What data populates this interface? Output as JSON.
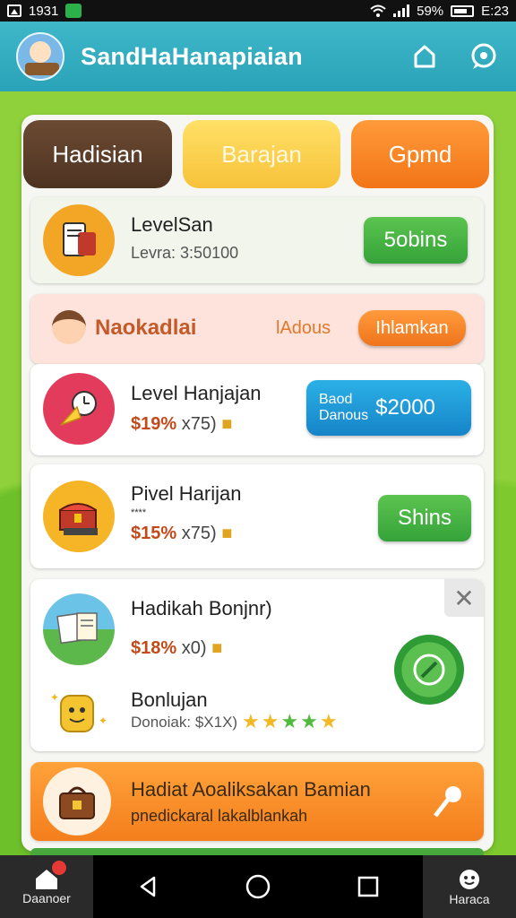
{
  "status_bar": {
    "left_text": "1931",
    "battery": "59%",
    "time": "E:23"
  },
  "header": {
    "title": "SandHaHanapiaian"
  },
  "tabs": [
    "Hadisian",
    "Barajan",
    "Gpmd"
  ],
  "level_row": {
    "title": "LevelSan",
    "sub_label": "Levra:",
    "sub_value": "3:50100",
    "button": "5obins"
  },
  "promo_row": {
    "name": "Naokadlai",
    "aux": "lAdous",
    "button": "Ihlamkan"
  },
  "item_rows": [
    {
      "title": "Level Hanjajan",
      "price": "$19%",
      "meta": "x75)",
      "button_line1": "Baod",
      "button_line2": "Danous",
      "button_price": "$2000"
    },
    {
      "title": "Pivel Harijan",
      "tiny_note": "****",
      "price": "$15%",
      "meta": "x75)",
      "button": "Shins"
    },
    {
      "title": "Hadikah Bonjnr)",
      "price": "$18%",
      "meta": "x0)"
    }
  ],
  "bonus_row": {
    "title": "Bonlujan",
    "sub": "Donoiak: $X1X)"
  },
  "rating": {
    "filled_yellow": 3,
    "filled_green": 2
  },
  "footer_banner": {
    "title": "Hadiat Aoaliksakan Bamian",
    "sub": "pnedickaral lakalblankah"
  },
  "bottom_nav": {
    "left_label": "Daanoer",
    "right_label": "Haraca"
  },
  "colors": {
    "header": "#2aa3b8",
    "background": "#8fd13a",
    "accent_orange": "#f27517",
    "accent_green": "#35a33a",
    "accent_blue": "#1684c8"
  }
}
